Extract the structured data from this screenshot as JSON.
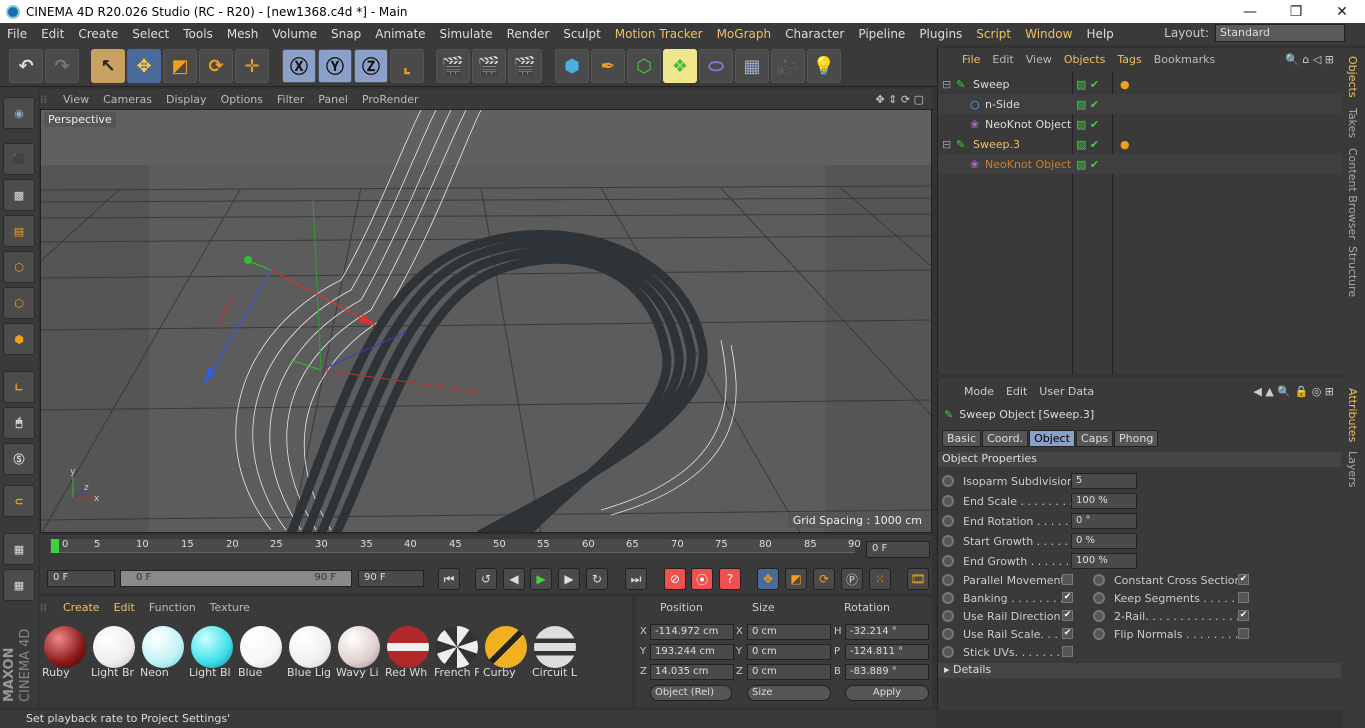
{
  "title": "CINEMA 4D R20.026 Studio (RC - R20) - [new1368.c4d *] - Main",
  "menu": [
    "File",
    "Edit",
    "Create",
    "Select",
    "Tools",
    "Mesh",
    "Volume",
    "Snap",
    "Animate",
    "Simulate",
    "Render",
    "Sculpt",
    "Motion Tracker",
    "MoGraph",
    "Character",
    "Pipeline",
    "Plugins",
    "Script",
    "Window",
    "Help"
  ],
  "layout": {
    "label": "Layout:",
    "value": "Standard"
  },
  "viewport_menu": [
    "View",
    "Cameras",
    "Display",
    "Options",
    "Filter",
    "Panel",
    "ProRender"
  ],
  "viewport": {
    "label": "Perspective",
    "grid_spacing": "Grid Spacing : 1000 cm"
  },
  "timeline": {
    "ticks": [
      "0",
      "5",
      "10",
      "15",
      "20",
      "25",
      "30",
      "35",
      "40",
      "45",
      "50",
      "55",
      "60",
      "65",
      "70",
      "75",
      "80",
      "85",
      "90"
    ],
    "current": "0 F"
  },
  "playback": {
    "start": "0 F",
    "range_start": "0 F",
    "range_end": "90 F",
    "end": "90 F"
  },
  "materials_menu": [
    "Create",
    "Edit",
    "Function",
    "Texture"
  ],
  "materials": [
    {
      "name": "Ruby",
      "color": "#8a1a1a"
    },
    {
      "name": "Light Br",
      "color": "#f4f4f4"
    },
    {
      "name": "Neon",
      "color": "#bff3f5"
    },
    {
      "name": "Light Bl",
      "color": "#3fe0ea"
    },
    {
      "name": "Blue",
      "color": "#ffffff"
    },
    {
      "name": "Blue Lig",
      "color": "#f6f6f6"
    },
    {
      "name": "Wavy Li",
      "color": "#e8dcd8"
    },
    {
      "name": "Red Wh",
      "color": "#b02828"
    },
    {
      "name": "French F",
      "color": "#6a7078"
    },
    {
      "name": "Curby",
      "color": "#e0a020"
    },
    {
      "name": "Circuit L",
      "color": "#d8d8d8"
    }
  ],
  "coords": {
    "headers": [
      "Position",
      "Size",
      "Rotation"
    ],
    "pos": [
      "-114.972 cm",
      "193.244 cm",
      "14.035 cm"
    ],
    "size": [
      "0 cm",
      "0 cm",
      "0 cm"
    ],
    "rot": [
      "-32.214 °",
      "-124.811 °",
      "-83.889 °"
    ],
    "axes_pos": [
      "X",
      "Y",
      "Z"
    ],
    "axes_size": [
      "X",
      "Y",
      "Z"
    ],
    "axes_rot": [
      "H",
      "P",
      "B"
    ],
    "mode": "Object (Rel)",
    "size_mode": "Size",
    "apply": "Apply"
  },
  "status": "Set playback rate to Project Settings'",
  "object_menu": [
    "File",
    "Edit",
    "View",
    "Objects",
    "Tags",
    "Bookmarks"
  ],
  "objects": [
    {
      "name": "Sweep",
      "indent": 0
    },
    {
      "name": "n-Side",
      "indent": 1
    },
    {
      "name": "NeoKnot Object",
      "indent": 1
    },
    {
      "name": "Sweep.3",
      "indent": 0
    },
    {
      "name": "NeoKnot Object",
      "indent": 1
    }
  ],
  "right_tabs": [
    "Objects",
    "Takes",
    "Content Browser",
    "Structure",
    "Attributes",
    "Layers"
  ],
  "attr_menu": [
    "Mode",
    "Edit",
    "User Data"
  ],
  "attr_title": "Sweep Object [Sweep.3]",
  "attr_tabs": [
    "Basic",
    "Coord.",
    "Object",
    "Caps",
    "Phong"
  ],
  "attr_section": "Object Properties",
  "props": [
    {
      "label": "Isoparm Subdivision",
      "value": "5"
    },
    {
      "label": "End Scale . . . . . . . . .",
      "value": "100 %"
    },
    {
      "label": "End Rotation . . . . . .",
      "value": "0 °"
    },
    {
      "label": "Start Growth . . . . . .",
      "value": "0 %"
    },
    {
      "label": "End Growth . . . . . . .",
      "value": "100 %"
    }
  ],
  "checks_left": [
    {
      "label": "Parallel Movement",
      "checked": false
    },
    {
      "label": "Banking . . . . . . . . .",
      "checked": true
    },
    {
      "label": "Use Rail Direction",
      "checked": true
    },
    {
      "label": "Use Rail Scale. . . .",
      "checked": true
    },
    {
      "label": "Stick UVs. . . . . . .",
      "checked": false
    }
  ],
  "checks_right": [
    {
      "label": "Constant Cross Section",
      "checked": true
    },
    {
      "label": "Keep Segments . . . . . .",
      "checked": false
    },
    {
      "label": "2-Rail. . . . . . . . . . . . . .",
      "checked": true
    },
    {
      "label": "Flip Normals . . . . . . . . .",
      "checked": false
    }
  ],
  "details": "Details",
  "brand": {
    "maxon": "MAXON",
    "cinema": "CINEMA 4D"
  }
}
